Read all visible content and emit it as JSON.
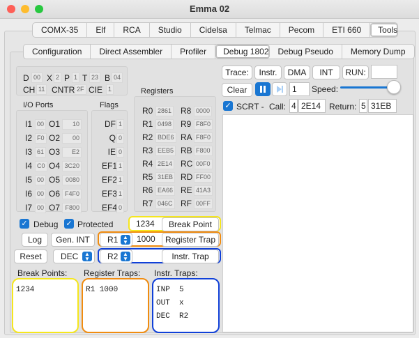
{
  "window": {
    "title": "Emma 02"
  },
  "top_tabs": [
    "COMX-35",
    "Elf",
    "RCA",
    "Studio",
    "Cidelsa",
    "Telmac",
    "Pecom",
    "ETI 660",
    "Tools"
  ],
  "sub_tabs": [
    "Configuration",
    "Direct Assembler",
    "Profiler",
    "Debug 1802",
    "Debug Pseudo",
    "Memory Dump"
  ],
  "cpu": {
    "D_label": "D",
    "D_val": "00",
    "X_label": "X",
    "X_val": "2",
    "P_label": "P",
    "P_val": "1",
    "T_label": "T",
    "T_val": "23",
    "B_label": "B",
    "B_val": "04",
    "CH_label": "CH",
    "CH_val": "11",
    "CNTR_label": "CNTR",
    "CNTR_val": "2F",
    "CIE_label": "CIE",
    "CIE_val": "1"
  },
  "io": {
    "title": "I/O Ports",
    "rows": [
      {
        "in_label": "I1",
        "in_val": "00",
        "out_label": "O1",
        "out_val": "10"
      },
      {
        "in_label": "I2",
        "in_val": "F0",
        "out_label": "O2",
        "out_val": "00"
      },
      {
        "in_label": "I3",
        "in_val": "61",
        "out_label": "O3",
        "out_val": "E2"
      },
      {
        "in_label": "I4",
        "in_val": "C0",
        "out_label": "O4",
        "out_val": "3C20"
      },
      {
        "in_label": "I5",
        "in_val": "00",
        "out_label": "O5",
        "out_val": "0080"
      },
      {
        "in_label": "I6",
        "in_val": "00",
        "out_label": "O6",
        "out_val": "F4F0"
      },
      {
        "in_label": "I7",
        "in_val": "00",
        "out_label": "O7",
        "out_val": "F800"
      }
    ]
  },
  "flags": {
    "title": "Flags",
    "rows": [
      {
        "label": "DF",
        "val": "1"
      },
      {
        "label": "Q",
        "val": "0"
      },
      {
        "label": "IE",
        "val": "0"
      },
      {
        "label": "EF1",
        "val": "1"
      },
      {
        "label": "EF2",
        "val": "1"
      },
      {
        "label": "EF3",
        "val": "1"
      },
      {
        "label": "EF4",
        "val": "0"
      }
    ]
  },
  "registers": {
    "title": "Registers",
    "rows": [
      {
        "l": "R0",
        "lv": "2861",
        "r": "R8",
        "rv": "0000"
      },
      {
        "l": "R1",
        "lv": "0498",
        "r": "R9",
        "rv": "F8F0"
      },
      {
        "l": "R2",
        "lv": "BDE6",
        "r": "RA",
        "rv": "F8F0"
      },
      {
        "l": "R3",
        "lv": "EEB5",
        "r": "RB",
        "rv": "F800"
      },
      {
        "l": "R4",
        "lv": "2E14",
        "r": "RC",
        "rv": "00F0"
      },
      {
        "l": "R5",
        "lv": "31EB",
        "r": "RD",
        "rv": "FF00"
      },
      {
        "l": "R6",
        "lv": "EA66",
        "r": "RE",
        "rv": "41A3"
      },
      {
        "l": "R7",
        "lv": "046C",
        "r": "RF",
        "rv": "00FF"
      }
    ]
  },
  "controls": {
    "debug_label": "Debug",
    "protected_label": "Protected",
    "break_value": "1234",
    "break_button": "Break Point",
    "log_button": "Log",
    "genint_button": "Gen. INT",
    "reg_select": "R1",
    "reg_value": "1000",
    "reg_button": "Register Trap",
    "reset_button": "Reset",
    "dec_select": "DEC",
    "instr_select": "R2",
    "instr_button": "Instr. Trap"
  },
  "lists": {
    "breakpoints_title": "Break Points:",
    "breakpoints_text": "1234",
    "regtraps_title": "Register Traps:",
    "regtraps_text": "R1 1000",
    "instrtraps_title": "Instr. Traps:",
    "instrtraps_text": "INP  5\nOUT  x\nDEC  R2"
  },
  "trace": {
    "trace_button": "Trace:",
    "instr_button": "Instr.",
    "dma_button": "DMA",
    "int_button": "INT",
    "run_label": "RUN:",
    "run_value": "",
    "clear_button": "Clear",
    "step_value": "1",
    "speed_label": "Speed:",
    "speed_level": 0.92,
    "scrt_label": "SCRT -",
    "call_label": "Call:",
    "call_count": "4",
    "call_addr": "2E14",
    "return_label": "Return:",
    "return_count": "5",
    "return_addr": "31EB",
    "output": ""
  },
  "colors": {
    "yellow": "#f5e61e",
    "orange": "#f08c10",
    "blue": "#1040d8",
    "accent": "#1976d2"
  }
}
